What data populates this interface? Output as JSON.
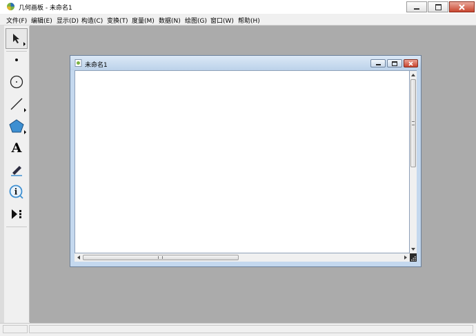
{
  "window": {
    "title": "几何画板 - 未命名1"
  },
  "menu": {
    "items": [
      "文件(F)",
      "编辑(E)",
      "显示(D)",
      "构造(C)",
      "变换(T)",
      "度量(M)",
      "数据(N)",
      "绘图(G)",
      "窗口(W)",
      "帮助(H)"
    ]
  },
  "toolbar": {
    "tools": [
      {
        "name": "selection-arrow-tool",
        "icon": "arrow-icon",
        "selected": true
      },
      {
        "name": "point-tool",
        "icon": "point-icon",
        "selected": false
      },
      {
        "name": "compass-tool",
        "icon": "circle-icon",
        "selected": false
      },
      {
        "name": "straightedge-tool",
        "icon": "line-icon",
        "selected": false
      },
      {
        "name": "polygon-tool",
        "icon": "polygon-icon",
        "selected": false
      },
      {
        "name": "text-tool",
        "icon": "text-icon",
        "label": "A",
        "selected": false
      },
      {
        "name": "marker-tool",
        "icon": "marker-icon",
        "selected": false
      },
      {
        "name": "information-tool",
        "icon": "info-icon",
        "label": "i",
        "selected": false
      },
      {
        "name": "custom-tool",
        "icon": "play-dots-icon",
        "selected": false
      }
    ]
  },
  "document": {
    "title": "未命名1"
  },
  "colors": {
    "workspace": "#ababab",
    "doc_frame": "#c4d8ee",
    "close_button": "#c8432d",
    "polygon_fill": "#3d8fd1"
  }
}
